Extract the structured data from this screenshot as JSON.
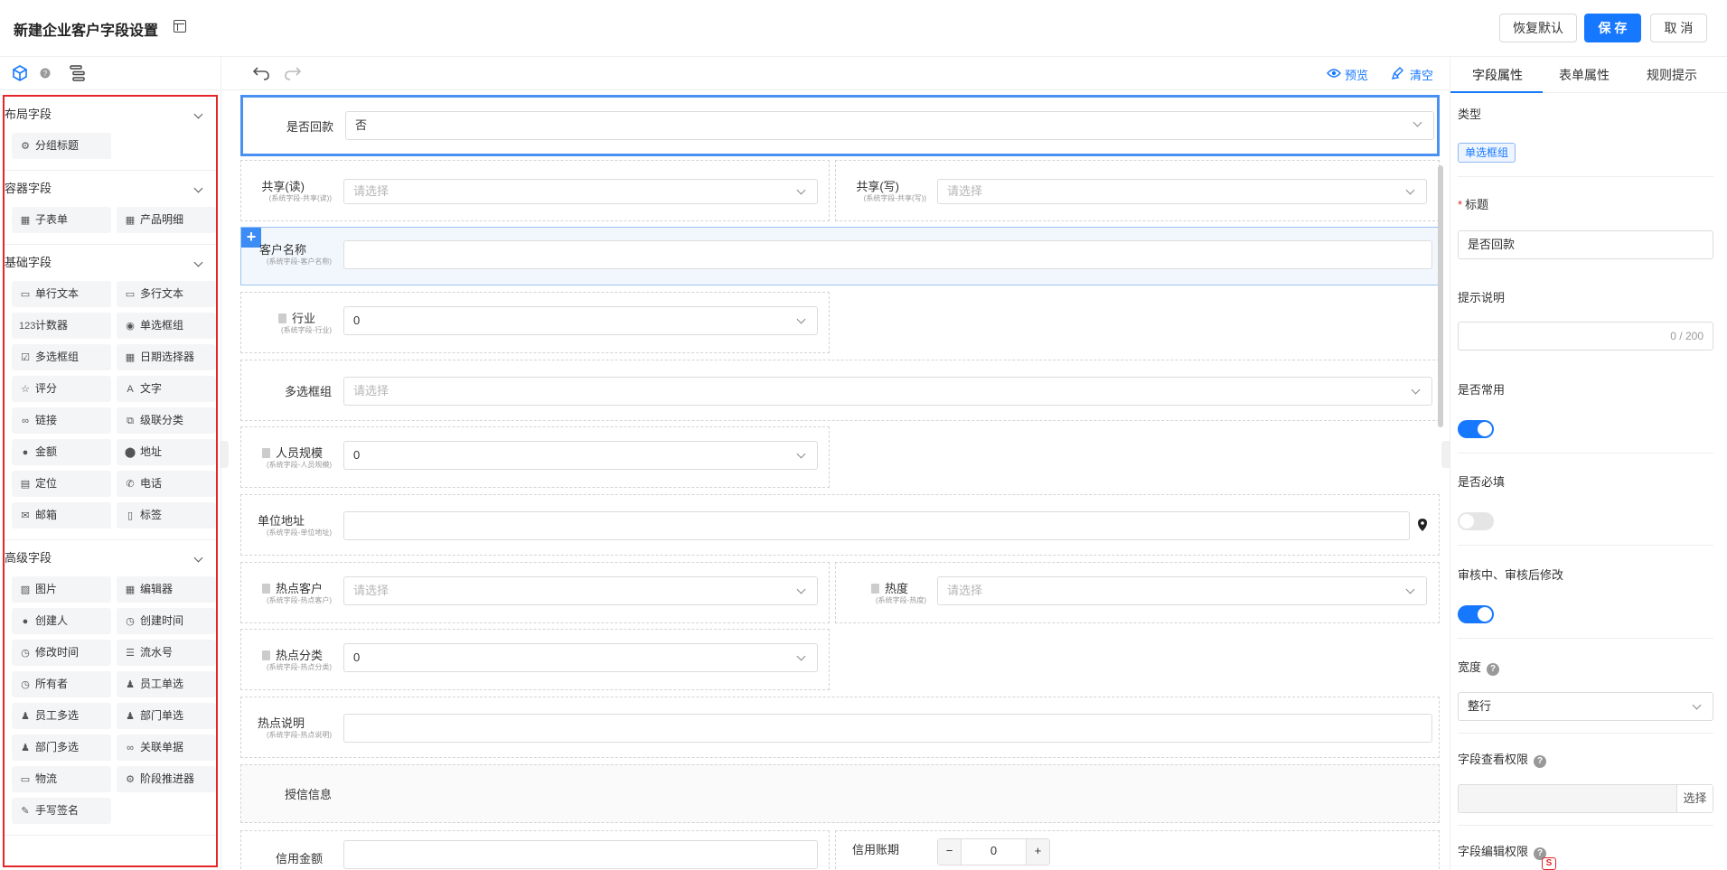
{
  "header": {
    "title": "新建企业客户字段设置",
    "restore_label": "恢复默认",
    "save_label": "保 存",
    "cancel_label": "取 消",
    "primary_color": "#1677ff"
  },
  "left": {
    "sections": [
      {
        "title": "布局字段",
        "items": [
          {
            "label": "分组标题",
            "icon": "group-title-icon"
          }
        ]
      },
      {
        "title": "容器字段",
        "items": [
          {
            "label": "子表单",
            "icon": "table-icon"
          },
          {
            "label": "产品明细",
            "icon": "table-icon"
          }
        ]
      },
      {
        "title": "基础字段",
        "items": [
          {
            "label": "单行文本",
            "icon": "input-icon"
          },
          {
            "label": "多行文本",
            "icon": "textarea-icon"
          },
          {
            "label": "计数器",
            "icon": "counter-icon"
          },
          {
            "label": "单选框组",
            "icon": "radio-icon"
          },
          {
            "label": "多选框组",
            "icon": "checkbox-icon"
          },
          {
            "label": "日期选择器",
            "icon": "calendar-icon"
          },
          {
            "label": "评分",
            "icon": "star-icon"
          },
          {
            "label": "文字",
            "icon": "text-icon"
          },
          {
            "label": "链接",
            "icon": "link-icon"
          },
          {
            "label": "级联分类",
            "icon": "cascade-icon"
          },
          {
            "label": "金额",
            "icon": "money-icon"
          },
          {
            "label": "地址",
            "icon": "location-icon"
          },
          {
            "label": "定位",
            "icon": "document-icon"
          },
          {
            "label": "电话",
            "icon": "phone-icon"
          },
          {
            "label": "邮箱",
            "icon": "mail-icon"
          },
          {
            "label": "标签",
            "icon": "tag-icon"
          }
        ]
      },
      {
        "title": "高级字段",
        "items": [
          {
            "label": "图片",
            "icon": "image-icon"
          },
          {
            "label": "编辑器",
            "icon": "editor-icon"
          },
          {
            "label": "创建人",
            "icon": "user-icon"
          },
          {
            "label": "创建时间",
            "icon": "clock-icon"
          },
          {
            "label": "修改时间",
            "icon": "clock-icon"
          },
          {
            "label": "流水号",
            "icon": "list-icon"
          },
          {
            "label": "所有者",
            "icon": "clock-icon"
          },
          {
            "label": "员工单选",
            "icon": "users-icon"
          },
          {
            "label": "员工多选",
            "icon": "users-icon"
          },
          {
            "label": "部门单选",
            "icon": "users-icon"
          },
          {
            "label": "部门多选",
            "icon": "users-icon"
          },
          {
            "label": "关联单据",
            "icon": "link-icon"
          },
          {
            "label": "物流",
            "icon": "truck-icon"
          },
          {
            "label": "阶段推进器",
            "icon": "stage-icon"
          },
          {
            "label": "手写签名",
            "icon": "signature-icon"
          }
        ]
      }
    ]
  },
  "toolbar": {
    "preview_label": "预览",
    "clear_label": "清空"
  },
  "canvas": {
    "huikuan": {
      "label": "是否回款",
      "value": "否"
    },
    "share_read": {
      "label": "共享(读)",
      "sub": "(系统字段-共享(读))",
      "placeholder": "请选择"
    },
    "share_write": {
      "label": "共享(写)",
      "sub": "(系统字段-共享(写))",
      "placeholder": "请选择"
    },
    "customer_name": {
      "label": "客户名称",
      "sub": "(系统字段-客户名称)"
    },
    "industry": {
      "label": "行业",
      "sub": "(系统字段-行业)",
      "value": "0"
    },
    "multi_check": {
      "label": "多选框组",
      "placeholder": "请选择"
    },
    "staff_size": {
      "label": "人员规模",
      "sub": "(系统字段-人员规模)",
      "value": "0"
    },
    "unit_addr": {
      "label": "单位地址",
      "sub": "(系统字段-单位地址)"
    },
    "hot_customer": {
      "label": "热点客户",
      "sub": "(系统字段-热点客户)",
      "placeholder": "请选择"
    },
    "heat": {
      "label": "热度",
      "sub": "(系统字段-热度)",
      "placeholder": "请选择"
    },
    "hot_category": {
      "label": "热点分类",
      "sub": "(系统字段-热点分类)",
      "value": "0"
    },
    "hot_desc": {
      "label": "热点说明",
      "sub": "(系统字段-热点说明)"
    },
    "credit_info": {
      "label": "授信信息"
    },
    "credit_amount": {
      "label": "信用金额"
    },
    "credit_period": {
      "label": "信用账期",
      "stepper_value": "0"
    }
  },
  "right": {
    "tabs": [
      "字段属性",
      "表单属性",
      "规则提示"
    ],
    "type_label": "类型",
    "type_value": "单选框组",
    "title_label": "标题",
    "title_value": "是否回款",
    "hint_label": "提示说明",
    "hint_counter": "0 / 200",
    "common_label": "是否常用",
    "common_on": true,
    "required_label": "是否必填",
    "required_on": false,
    "audit_label": "审核中、审核后修改",
    "audit_on": true,
    "width_label": "宽度",
    "width_value": "整行",
    "view_perm_label": "字段查看权限",
    "select_label": "选择",
    "edit_perm_label": "字段编辑权限"
  }
}
